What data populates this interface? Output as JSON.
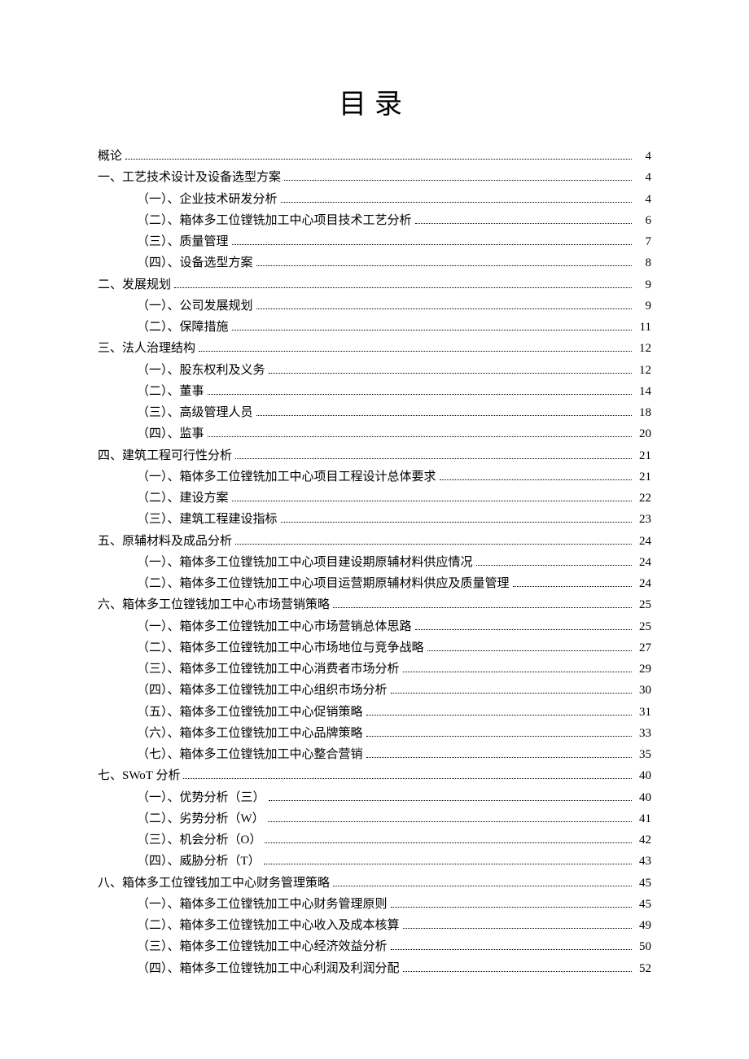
{
  "title": "目录",
  "entries": [
    {
      "level": 0,
      "text": "概论",
      "page": "4"
    },
    {
      "level": 0,
      "text": "一、工艺技术设计及设备选型方案",
      "page": "4"
    },
    {
      "level": 1,
      "text": "（一）、企业技术研发分析",
      "page": "4"
    },
    {
      "level": 1,
      "text": "（二）、箱体多工位镗铣加工中心项目技术工艺分析",
      "page": "6"
    },
    {
      "level": 1,
      "text": "（三）、质量管理",
      "page": "7"
    },
    {
      "level": 1,
      "text": "（四）、设备选型方案",
      "page": "8"
    },
    {
      "level": 0,
      "text": "二、发展规划",
      "page": "9"
    },
    {
      "level": 1,
      "text": "（一）、公司发展规划",
      "page": "9"
    },
    {
      "level": 1,
      "text": "（二）、保障措施",
      "page": "11"
    },
    {
      "level": 0,
      "text": "三、法人治理结构",
      "page": "12"
    },
    {
      "level": 1,
      "text": "（一）、股东权利及义务",
      "page": "12"
    },
    {
      "level": 1,
      "text": "（二）、董事",
      "page": "14"
    },
    {
      "level": 1,
      "text": "（三）、高级管理人员",
      "page": "18"
    },
    {
      "level": 1,
      "text": "（四）、监事",
      "page": "20"
    },
    {
      "level": 0,
      "text": "四、建筑工程可行性分析",
      "page": "21"
    },
    {
      "level": 1,
      "text": "（一）、箱体多工位镗铣加工中心项目工程设计总体要求",
      "page": "21"
    },
    {
      "level": 1,
      "text": "（二）、建设方案",
      "page": "22"
    },
    {
      "level": 1,
      "text": "（三）、建筑工程建设指标",
      "page": "23"
    },
    {
      "level": 0,
      "text": "五、原辅材料及成品分析",
      "page": "24"
    },
    {
      "level": 1,
      "text": "（一）、箱体多工位镗铣加工中心项目建设期原辅材料供应情况",
      "page": "24"
    },
    {
      "level": 1,
      "text": "（二）、箱体多工位镗铣加工中心项目运营期原辅材料供应及质量管理",
      "page": "24"
    },
    {
      "level": 0,
      "text": "六、箱体多工位镗钱加工中心市场营销策略",
      "page": "25"
    },
    {
      "level": 1,
      "text": "（一）、箱体多工位镗铣加工中心市场营销总体思路",
      "page": "25"
    },
    {
      "level": 1,
      "text": "（二）、箱体多工位镗铣加工中心市场地位与竞争战略",
      "page": "27"
    },
    {
      "level": 1,
      "text": "（三）、箱体多工位镗铣加工中心消费者市场分析",
      "page": "29"
    },
    {
      "level": 1,
      "text": "（四）、箱体多工位镗铣加工中心组织市场分析",
      "page": "30"
    },
    {
      "level": 1,
      "text": "（五）、箱体多工位镗铣加工中心促销策略",
      "page": "31"
    },
    {
      "level": 1,
      "text": "（六）、箱体多工位镗铣加工中心品牌策略",
      "page": "33"
    },
    {
      "level": 1,
      "text": "（七）、箱体多工位镗铣加工中心整合营销",
      "page": "35"
    },
    {
      "level": 0,
      "text": "七、SWoT 分析",
      "page": "40"
    },
    {
      "level": 1,
      "text": "（一）、优势分析（三）",
      "page": "40"
    },
    {
      "level": 1,
      "text": "（二）、劣势分析（W）",
      "page": "41"
    },
    {
      "level": 1,
      "text": "（三）、机会分析（O）",
      "page": "42"
    },
    {
      "level": 1,
      "text": "（四）、威胁分析（T）",
      "page": "43"
    },
    {
      "level": 0,
      "text": "八、箱体多工位镗钱加工中心财务管理策略",
      "page": "45"
    },
    {
      "level": 1,
      "text": "（一）、箱体多工位镗铣加工中心财务管理原则",
      "page": "45"
    },
    {
      "level": 1,
      "text": "（二）、箱体多工位镗铣加工中心收入及成本核算",
      "page": "49"
    },
    {
      "level": 1,
      "text": "（三）、箱体多工位镗铣加工中心经济效益分析",
      "page": "50"
    },
    {
      "level": 1,
      "text": "（四）、箱体多工位镗铣加工中心利润及利润分配",
      "page": "52"
    }
  ]
}
